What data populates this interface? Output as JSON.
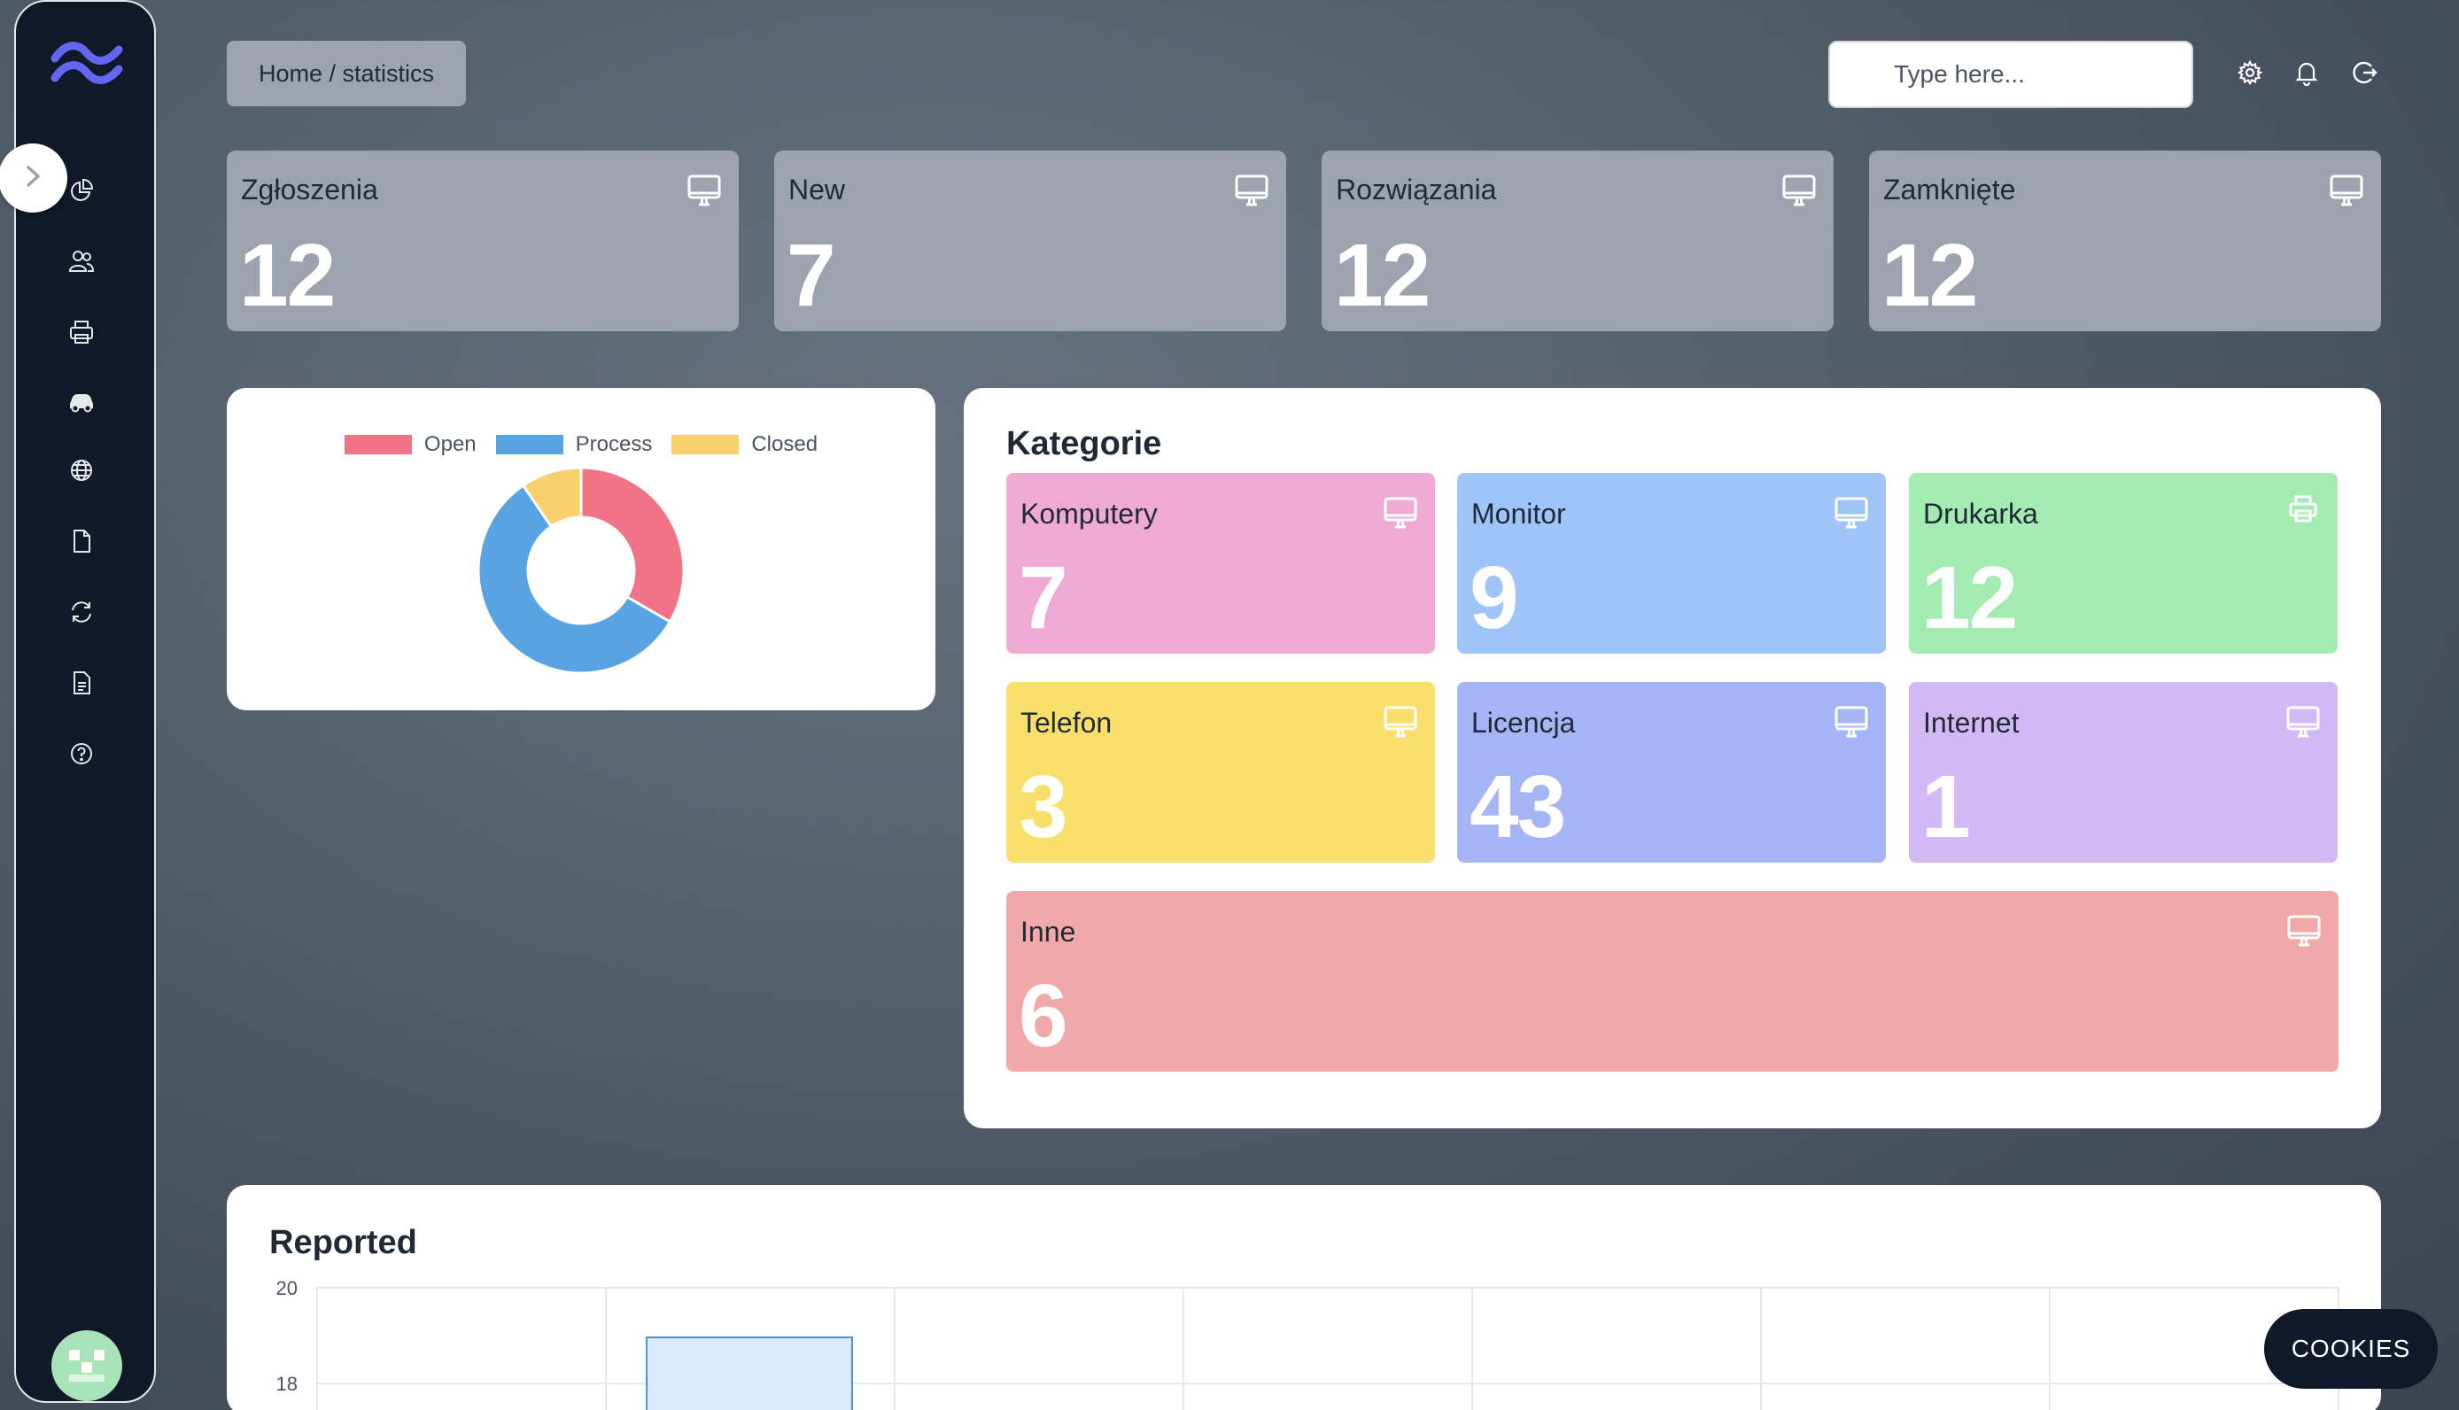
{
  "sidebar": {
    "items": [
      {
        "icon": "chart-pie-icon"
      },
      {
        "icon": "users-icon"
      },
      {
        "icon": "printer-icon"
      },
      {
        "icon": "car-icon"
      },
      {
        "icon": "globe-icon"
      },
      {
        "icon": "document-icon"
      },
      {
        "icon": "refresh-icon"
      },
      {
        "icon": "document-text-icon"
      },
      {
        "icon": "help-icon"
      }
    ]
  },
  "header": {
    "breadcrumb": "Home / statistics",
    "search_placeholder": "Type here..."
  },
  "stats": [
    {
      "label": "Zgłoszenia",
      "value": "12"
    },
    {
      "label": "New",
      "value": "7"
    },
    {
      "label": "Rozwiązania",
      "value": "12"
    },
    {
      "label": "Zamknięte",
      "value": "12"
    }
  ],
  "donut": {
    "legend": [
      {
        "label": "Open",
        "color": "#f07386"
      },
      {
        "label": "Process",
        "color": "#58a3e2"
      },
      {
        "label": "Closed",
        "color": "#f8d16d"
      }
    ]
  },
  "kategorie": {
    "title": "Kategorie",
    "items": [
      {
        "label": "Komputery",
        "value": "7",
        "color": "#eeaad3"
      },
      {
        "label": "Monitor",
        "value": "9",
        "color": "#9fc5f8"
      },
      {
        "label": "Drukarka",
        "value": "12",
        "color": "#a3ebb1"
      },
      {
        "label": "Telefon",
        "value": "3",
        "color": "#f8de6a"
      },
      {
        "label": "Licencja",
        "value": "43",
        "color": "#a5b4f4"
      },
      {
        "label": "Internet",
        "value": "1",
        "color": "#d3b8f6"
      },
      {
        "label": "Inne",
        "value": "6",
        "color": "#f0a8a8"
      }
    ]
  },
  "reported": {
    "title": "Reported",
    "y_ticks": [
      "20",
      "18"
    ]
  },
  "chart_data": {
    "type": "pie",
    "categories": [
      "Open",
      "Process",
      "Closed"
    ],
    "values": [
      7,
      12,
      2
    ],
    "colors": [
      "#f07386",
      "#58a3e2",
      "#f8d16d"
    ],
    "donut": true
  },
  "cookies_label": "COOKIES"
}
